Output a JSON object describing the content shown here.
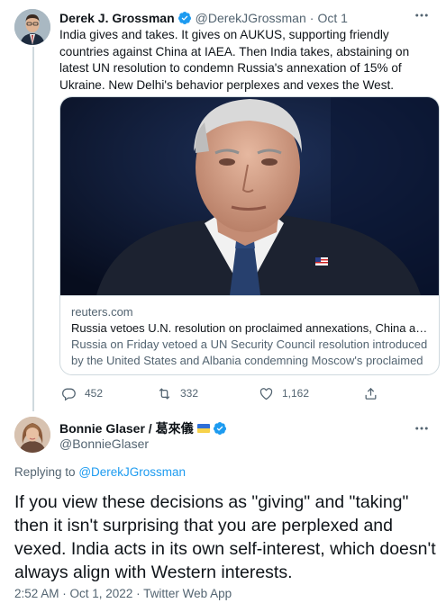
{
  "colors": {
    "text": "#0f1419",
    "secondary": "#536471",
    "link": "#1d9bf0",
    "border": "#cfd9de"
  },
  "parent_tweet": {
    "author_name": "Derek J. Grossman",
    "handle": "@DerekJGrossman",
    "separator": "·",
    "date": "Oct 1",
    "more_icon": "ellipsis-icon",
    "text": "India gives and takes. It gives on AUKUS, supporting friendly countries against China at IAEA. Then India takes, abstaining on latest UN resolution to condemn Russia's annexation of 15% of Ukraine. New Delhi's behavior perplexes and vexes the West.",
    "card": {
      "domain": "reuters.com",
      "title": "Russia vetoes U.N. resolution on proclaimed annexations, China abst…",
      "description": "Russia on Friday vetoed a UN Security Council resolution introduced by the United States and Albania condemning Moscow's proclaimed …"
    },
    "actions": {
      "replies": "452",
      "retweets": "332",
      "likes": "1,162"
    }
  },
  "main_tweet": {
    "author_name": "Bonnie Glaser / 葛來儀",
    "handle": "@BonnieGlaser",
    "replying_prefix": "Replying to",
    "replying_to": "@DerekJGrossman",
    "text": "If you view these decisions as \"giving\" and \"taking\" then it isn't surprising that you are perplexed and vexed. India acts in its own self-interest, which doesn't always align with Western interests.",
    "timestamp": "2:52 AM · Oct 1, 2022 · Twitter Web App"
  }
}
